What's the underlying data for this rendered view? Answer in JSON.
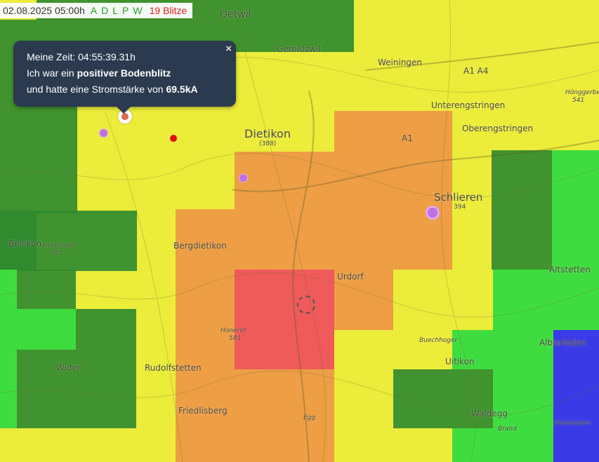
{
  "status": {
    "datetime": "02.08.2025 05:00h",
    "options": [
      "A",
      "D",
      "L",
      "P",
      "W"
    ],
    "count_label": "19 Blitze"
  },
  "popup": {
    "line1": "Meine Zeit: 04:55:39.31h",
    "line2_prefix": "Ich war ein ",
    "line2_bold": "positiver Bodenblitz",
    "line3_prefix": "und hatte eine Stromstärke von ",
    "line3_bold": "69.5kA",
    "close_glyph": "×"
  },
  "map": {
    "places": {
      "oetwil": "Oetwil",
      "geroldswil": "Geroldswil",
      "weiningen": "Weiningen",
      "unterengstringen": "Unterengstringen",
      "oberengstringen": "Oberengstringen",
      "honggerberg": "Hönggerberg",
      "honggerberg_elev": "541",
      "dietikon": "Dietikon",
      "dietikon_elev": "(388)",
      "schlieren": "Schlieren",
      "schlieren_elev": "394",
      "bellikon": "Bellikon",
      "eitersberg": "eitersberg",
      "eitersberg_elev": "787",
      "bergdietikon": "Bergdietikon",
      "urdorf": "Urdorf",
      "altstetten": "Altstetten",
      "honeret": "Honeret",
      "honeret_elev": "581",
      "buechhoger": "Buechhoger",
      "albisrieden": "Albisrieden",
      "uitikon": "Uitikon",
      "widen": "Widen",
      "rudolfstetten": "Rudolfstetten",
      "friedlisberg": "Friedlisberg",
      "egg": "Egg",
      "waldegg": "Waldegg",
      "brand": "Brand",
      "hohenstein": "Hohenstein",
      "road": "A1 A4",
      "road2": "A1"
    },
    "density_colors": {
      "blue": "#3a3ae6",
      "green": "#3fdc3f",
      "darkgreen": "#2f8a2f",
      "yellow": "#ecec3a",
      "orange": "#ee9a45",
      "red": "#ef5a5a"
    },
    "strike_colors": {
      "positive": "#e01010",
      "old": "#c070e0"
    }
  }
}
